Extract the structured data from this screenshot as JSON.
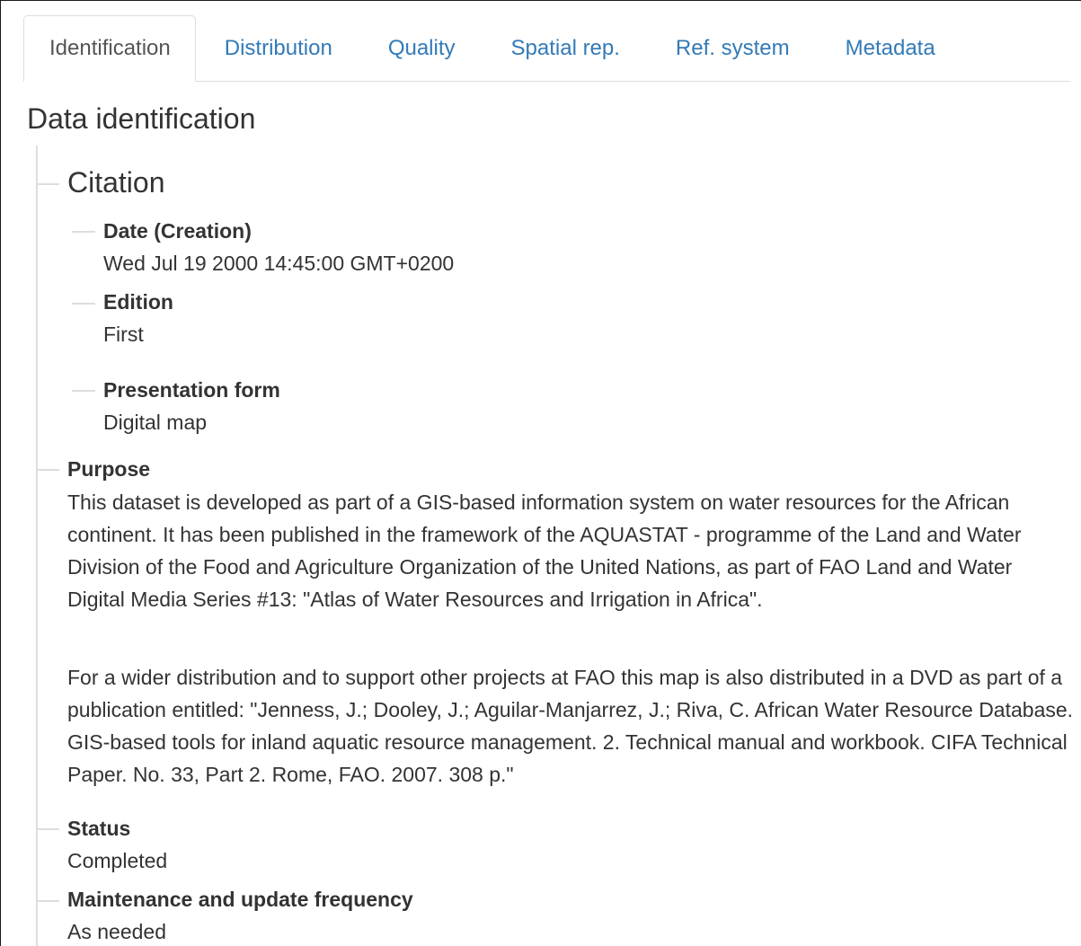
{
  "tabs": [
    {
      "label": "Identification",
      "active": true
    },
    {
      "label": "Distribution",
      "active": false
    },
    {
      "label": "Quality",
      "active": false
    },
    {
      "label": "Spatial rep.",
      "active": false
    },
    {
      "label": "Ref. system",
      "active": false
    },
    {
      "label": "Metadata",
      "active": false
    }
  ],
  "page_title": "Data identification",
  "citation": {
    "title": "Citation",
    "date_label": "Date (Creation)",
    "date_value": "Wed Jul 19 2000 14:45:00 GMT+0200",
    "edition_label": "Edition",
    "edition_value": "First",
    "presentation_label": "Presentation form",
    "presentation_value": "Digital map"
  },
  "purpose": {
    "label": "Purpose",
    "paragraph1": "This dataset is developed as part of a GIS-based information system on water resources for the African continent. It has been published in the framework of the AQUASTAT - programme of the Land and Water Division of the Food and Agriculture Organization of the United Nations, as part of FAO Land and Water Digital Media Series #13: \"Atlas of Water Resources and Irrigation in Africa\".",
    "paragraph2": "For a wider distribution and to support other projects at FAO this map is also distributed in a DVD as part of a publication entitled: \"Jenness, J.; Dooley, J.; Aguilar-Manjarrez, J.; Riva, C. African Water Resource Database. GIS-based tools for inland aquatic resource management. 2. Technical manual and workbook. CIFA Technical Paper. No. 33, Part 2. Rome, FAO. 2007. 308 p.\""
  },
  "status": {
    "label": "Status",
    "value": "Completed"
  },
  "maintenance": {
    "label": "Maintenance and update frequency",
    "value": "As needed"
  },
  "colors": {
    "link": "#337ab7",
    "text": "#333333",
    "active_tab_text": "#555555",
    "border": "#dddddd"
  }
}
